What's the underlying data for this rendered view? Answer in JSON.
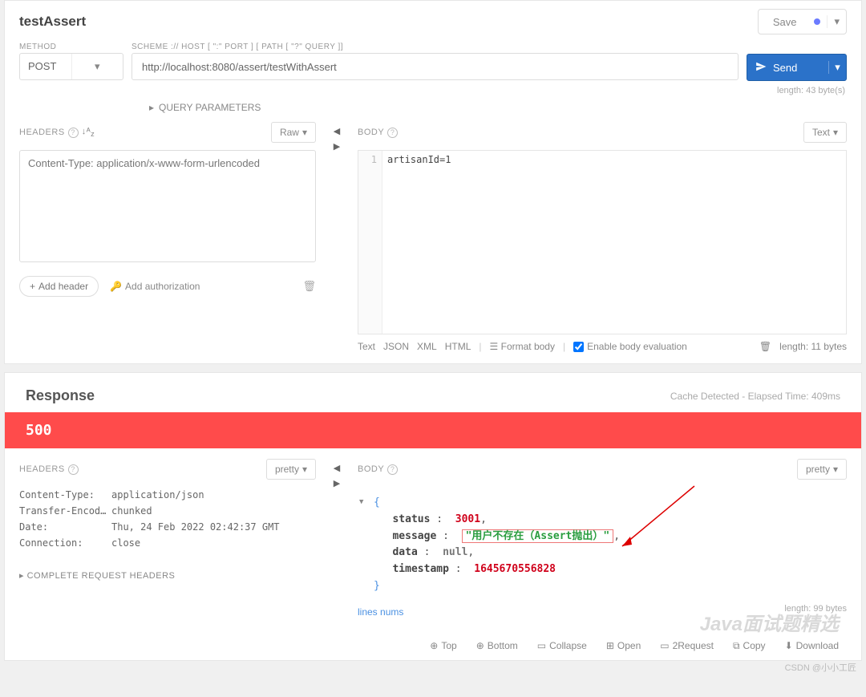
{
  "header": {
    "title": "testAssert",
    "save": "Save"
  },
  "method": {
    "label": "METHOD",
    "value": "POST"
  },
  "url": {
    "label": "SCHEME :// HOST [ \":\" PORT ] [ PATH [ \"?\" QUERY ]]",
    "value": "http://localhost:8080/assert/testWithAssert",
    "length": "length: 43 byte(s)"
  },
  "send": "Send",
  "queryParams": "QUERY PARAMETERS",
  "reqHeaders": {
    "title": "HEADERS",
    "raw": "Raw",
    "value": "Content-Type: application/x-www-form-urlencoded",
    "addHeader": "Add header",
    "addAuth": "Add authorization"
  },
  "reqBody": {
    "title": "BODY",
    "text": "Text",
    "lineNo": "1",
    "content": "artisanId=1",
    "fmtText": "Text",
    "fmtJson": "JSON",
    "fmtXml": "XML",
    "fmtHtml": "HTML",
    "formatBody": "Format body",
    "enableEval": "Enable body evaluation",
    "length": "length: 11 bytes"
  },
  "response": {
    "title": "Response",
    "timing": "Cache Detected - Elapsed Time: 409ms",
    "status": "500",
    "headers": {
      "title": "HEADERS",
      "pretty": "pretty",
      "rows": [
        {
          "k": "Content-Type:",
          "v": "application/json"
        },
        {
          "k": "Transfer-Encodin…",
          "v": "chunked"
        },
        {
          "k": "Date:",
          "v": "Thu, 24 Feb 2022 02:42:37 GMT"
        },
        {
          "k": "Connection:",
          "v": "close"
        }
      ],
      "complete": "COMPLETE REQUEST HEADERS"
    },
    "body": {
      "title": "BODY",
      "pretty": "pretty",
      "json": {
        "status_k": "status",
        "status_v": "3001",
        "message_k": "message",
        "message_v": "\"用户不存在（Assert抛出）\"",
        "data_k": "data",
        "data_v": "null",
        "ts_k": "timestamp",
        "ts_v": "1645670556828"
      },
      "linesNums": "lines nums",
      "length": "length: 99 bytes"
    },
    "footer": {
      "top": "Top",
      "bottom": "Bottom",
      "collapse": "Collapse",
      "open": "Open",
      "req": "2Request",
      "copy": "Copy",
      "download": "Download"
    }
  },
  "watermark": "Java面试题精选",
  "credit": "CSDN @小小工匠"
}
